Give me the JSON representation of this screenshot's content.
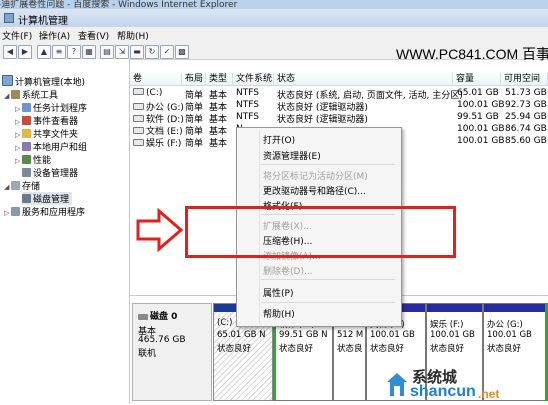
{
  "top_strip": {
    "left": "-迪扩展卷性问题 - 百度搜索 - Windows Internet Explorer"
  },
  "window": {
    "title": "计算机管理"
  },
  "menu": {
    "items": [
      "文件(F)",
      "操作(A)",
      "查看(V)",
      "帮助(H)"
    ]
  },
  "watermark": "WWW.PC841.COM 百事网",
  "tree": {
    "root": "计算机管理(本地)",
    "items": [
      "系统工具",
      "任务计划程序",
      "事件查看器",
      "共享文件夹",
      "本地用户和组",
      "性能",
      "设备管理器",
      "存储",
      "磁盘管理",
      "服务和应用程序"
    ]
  },
  "volumes": {
    "headers": [
      "卷",
      "布局",
      "类型",
      "文件系统",
      "状态",
      "容量",
      "可用空间"
    ],
    "rows": [
      {
        "name": "(C:)",
        "layout": "简单",
        "type": "基本",
        "fs": "NTFS",
        "status": "状态良好 (系统, 启动, 页面文件, 活动, 主分区)",
        "capacity": "65.01 GB",
        "free": "51.73 GB"
      },
      {
        "name": "办公 (G:)",
        "layout": "简单",
        "type": "基本",
        "fs": "NTFS",
        "status": "状态良好 (逻辑驱动器)",
        "capacity": "100.01 GB",
        "free": "92.73 GB"
      },
      {
        "name": "软件 (D:)",
        "layout": "简单",
        "type": "基本",
        "fs": "NTFS",
        "status": "状态良好 (逻辑驱动器)",
        "capacity": "99.51 GB",
        "free": "25.94 GB"
      },
      {
        "name": "文档 (E:)",
        "layout": "简单",
        "type": "基本",
        "fs": "N",
        "status": "",
        "capacity": "100.01 GB",
        "free": "86.74 GB"
      },
      {
        "name": "娱乐 (F:)",
        "layout": "简单",
        "type": "基本",
        "fs": "N",
        "status": "",
        "capacity": "100.01 GB",
        "free": "85.60 GB"
      }
    ]
  },
  "context_menu": {
    "items": [
      {
        "label": "打开(O)",
        "disabled": false
      },
      {
        "label": "资源管理器(E)",
        "disabled": false
      },
      {
        "label": "将分区标记为活动分区(M)",
        "disabled": true
      },
      {
        "label": "更改驱动器号和路径(C)...",
        "disabled": false
      },
      {
        "label": "格式化(F)...",
        "disabled": false
      },
      {
        "label": "扩展卷(X)...",
        "disabled": true
      },
      {
        "label": "压缩卷(H)...",
        "disabled": false
      },
      {
        "label": "添加镜像(A)...",
        "disabled": true
      },
      {
        "label": "删除卷(D)...",
        "disabled": true
      },
      {
        "label": "属性(P)",
        "disabled": false
      },
      {
        "label": "帮助(H)",
        "disabled": false
      }
    ]
  },
  "disk": {
    "name": "磁盘 0",
    "type": "基本",
    "size": "465.76 GB",
    "status": "联机"
  },
  "partitions": [
    {
      "name": "(C:)",
      "size": "65.01 GB N",
      "status": "状态良好"
    },
    {
      "name": "软件 (D:)",
      "size": "99.51 GB N",
      "status": "状态良好"
    },
    {
      "name": "",
      "size": "512 M",
      "status": "状态良"
    },
    {
      "name": "文档 (E:)",
      "size": "100.01 GB",
      "status": "状态良好"
    },
    {
      "name": "娱乐 (F:)",
      "size": "100.01 GB",
      "status": "状态良好"
    },
    {
      "name": "办公 (G:)",
      "size": "100.01 GB",
      "status": "状态良好"
    }
  ],
  "logo": {
    "text1": "系统城",
    "text2": "shancun",
    "text3": ".net"
  },
  "colors": {
    "highlight_box": "#e2211c",
    "arrow": "#e2211c",
    "partition_bar_primary": "#1a3a9a",
    "partition_bar_logical": "#2a2aa0",
    "partition_logical_border": "#2aa82a"
  }
}
